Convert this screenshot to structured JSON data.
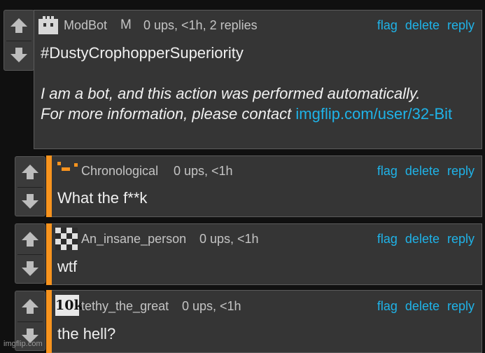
{
  "comments": [
    {
      "username": "ModBot",
      "badge": "M",
      "meta": "0 ups, <1h, 2 replies",
      "line1": "#DustyCrophopperSuperiority",
      "italic_line1": "I am a bot, and this action was performed automatically.",
      "italic_line2": "For more information, please contact",
      "link": "imgflip.com/user/32-Bit",
      "actions": [
        "flag",
        "delete",
        "reply"
      ]
    },
    {
      "username": "Chronological",
      "meta": "0 ups, <1h",
      "text": "What the f**k",
      "actions": [
        "flag",
        "delete",
        "reply"
      ]
    },
    {
      "username": "An_insane_person",
      "meta": "0 ups, <1h",
      "text": "wtf",
      "actions": [
        "flag",
        "delete",
        "reply"
      ]
    },
    {
      "username": "tethy_the_great",
      "avatar_text": "10k",
      "meta": "0 ups, <1h",
      "text": "the hell?",
      "actions": [
        "flag",
        "delete",
        "reply"
      ]
    }
  ],
  "watermark": "imgflip.com",
  "colors": {
    "link": "#1fb3e8",
    "accent_stripe": "#f7931e",
    "panel": "#353535"
  },
  "icons": [
    "upvote-arrow-icon",
    "downvote-arrow-icon"
  ]
}
